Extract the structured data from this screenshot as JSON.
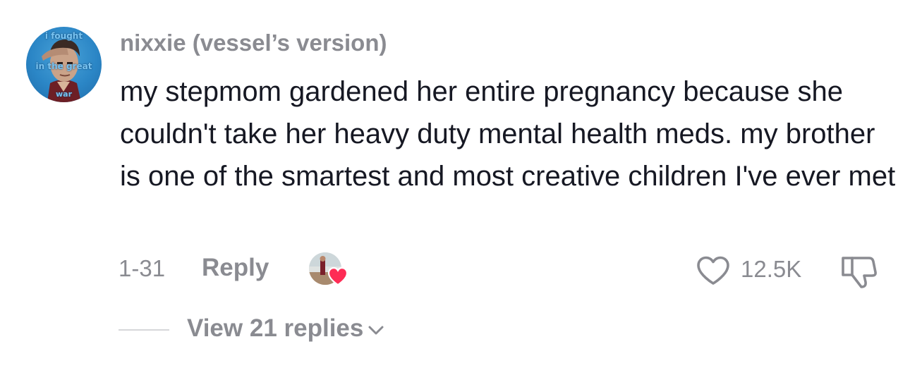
{
  "comment": {
    "avatar_caption": [
      "i fought",
      "in the great",
      "war"
    ],
    "username": "nixxie (vessel’s version)",
    "text": "my stepmom gardened her entire pregnancy because she couldn't take her heavy duty mental health meds. my brother is one of the smartest and most creative children I've ever met",
    "date": "1-31",
    "reply_label": "Reply",
    "like_count": "12.5K",
    "creator_liked": true,
    "view_replies_label": "View 21 replies"
  },
  "colors": {
    "text_primary": "#161823",
    "text_secondary": "#8a8b91",
    "heart_red": "#fe2c55",
    "divider": "#d6d7da"
  },
  "icons": {
    "like": "heart-outline-icon",
    "dislike": "thumbs-down-icon",
    "creator_like": "heart-filled-icon",
    "expand": "chevron-down-icon"
  }
}
